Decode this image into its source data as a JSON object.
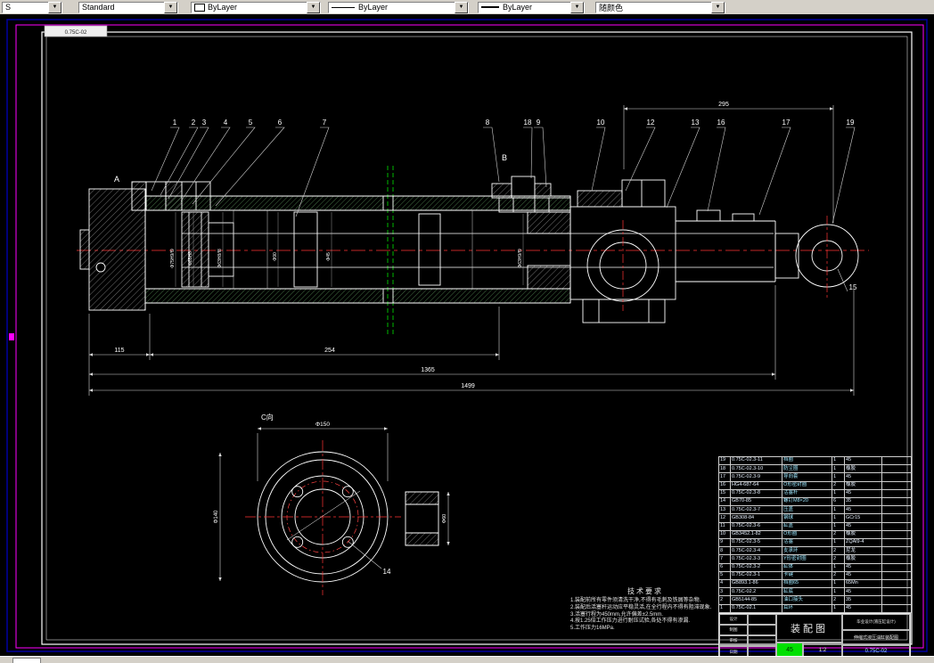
{
  "toolbar": {
    "combos": [
      {
        "label": "S"
      },
      {
        "label": "Standard"
      },
      {
        "label": "ByLayer"
      },
      {
        "label": "ByLayer"
      },
      {
        "label": "ByLayer"
      },
      {
        "label": "随颜色"
      }
    ]
  },
  "frame": {
    "stamp": "0.75C-02"
  },
  "colors": {
    "centerline": "#ff3333",
    "section_line": "#00cc00",
    "frame_magenta": "#ff00ff",
    "frame_navy": "#0000a0",
    "hatch_green": "#86d986",
    "line": "#ffffff",
    "highlight_green": "#00e000"
  },
  "drawing": {
    "view_labels": {
      "a": "A",
      "b": "B",
      "c": "C向"
    },
    "callouts": [
      "1",
      "2",
      "3",
      "4",
      "5",
      "6",
      "7",
      "8",
      "18",
      "9",
      "10",
      "12",
      "13",
      "16",
      "17",
      "19",
      "15",
      "14"
    ],
    "dims": {
      "top": "295",
      "d115": "115",
      "d254": "254",
      "d1365": "1365",
      "overall": "1499",
      "rotated": [
        "Φ75H9/f9",
        "Φ85H8",
        "Φ63H8/f8",
        "Φ90",
        "Φ45",
        "Φ63H9/f9"
      ],
      "end_view_top": "Φ150",
      "end_view_left": "Φ140",
      "flange": "Φ60"
    }
  },
  "tech_requirements": {
    "title": "技术要求",
    "items": [
      "1.装配前所有零件须清洗干净,不得有毛刺及铁屑等杂物.",
      "2.装配后活塞杆运动应平稳灵活,在全行程内不得有阻滞现象.",
      "3.活塞行程为450mm,允许偏差±2.5mm.",
      "4.按1.25倍工作压力进行耐压试验,各处不得有渗漏.",
      "5.工作压力16MPa."
    ]
  },
  "bom": {
    "rows": [
      [
        "19",
        "0.75C-02.3-11",
        "挡圈",
        "1",
        "45",
        ""
      ],
      [
        "18",
        "0.75C-02.3-10",
        "防尘圈",
        "1",
        "橡胶",
        ""
      ],
      [
        "17",
        "0.75C-02.3-9",
        "导向套",
        "1",
        "45",
        ""
      ],
      [
        "16",
        "HG4-687-64",
        "O形密封圈",
        "2",
        "橡胶",
        ""
      ],
      [
        "15",
        "0.75C-02.3-8",
        "活塞杆",
        "1",
        "45",
        ""
      ],
      [
        "14",
        "GB70-85",
        "螺钉M8×20",
        "6",
        "35",
        ""
      ],
      [
        "13",
        "0.75C-02.3-7",
        "压盖",
        "1",
        "45",
        ""
      ],
      [
        "12",
        "GB308-84",
        "钢球",
        "1",
        "GCr15",
        ""
      ],
      [
        "11",
        "0.75C-02.3-6",
        "缸盖",
        "1",
        "45",
        ""
      ],
      [
        "10",
        "GB3452.1-82",
        "O形圈",
        "2",
        "橡胶",
        ""
      ],
      [
        "9",
        "0.75C-02.3-5",
        "活塞",
        "1",
        "ZQAl9-4",
        ""
      ],
      [
        "8",
        "0.75C-02.3-4",
        "支承环",
        "2",
        "尼龙",
        ""
      ],
      [
        "7",
        "0.75C-02.3-3",
        "Y形密封圈",
        "2",
        "橡胶",
        ""
      ],
      [
        "6",
        "0.75C-02.3-2",
        "缸体",
        "1",
        "45",
        ""
      ],
      [
        "5",
        "0.75C-02.3-1",
        "卡键",
        "2",
        "45",
        ""
      ],
      [
        "4",
        "GB893.1-86",
        "挡圈65",
        "1",
        "65Mn",
        ""
      ],
      [
        "3",
        "0.75C-02.2",
        "缸底",
        "1",
        "45",
        ""
      ],
      [
        "2",
        "GB5144-85",
        "油口接头",
        "2",
        "35",
        ""
      ],
      [
        "1",
        "0.75C-02.1",
        "耳环",
        "1",
        "45",
        ""
      ]
    ]
  },
  "title_block": {
    "name": "装配图",
    "sign_labels": [
      "设计",
      "制图",
      "审核",
      "日期"
    ],
    "scale": "1:2",
    "material": "45",
    "project": "毕业设计(液压缸设计)",
    "drawing_title": "伸缩式液压油缸装配图",
    "drawing_no": "0.75C-02"
  }
}
